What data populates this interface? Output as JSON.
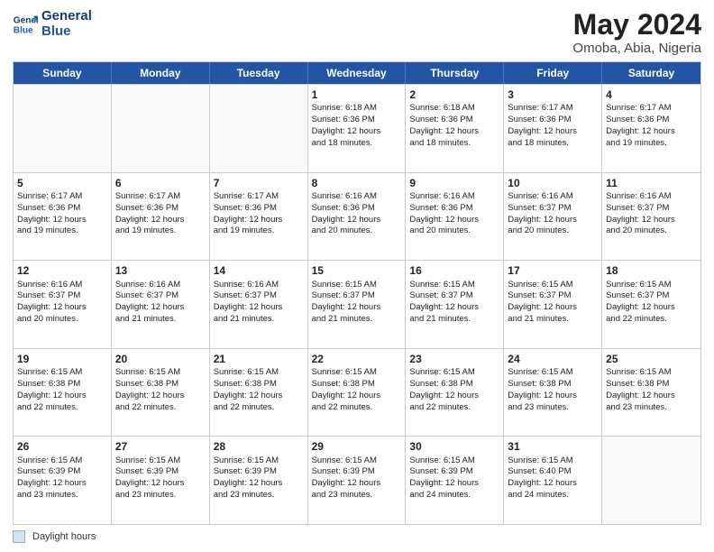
{
  "header": {
    "logo_line1": "General",
    "logo_line2": "Blue",
    "title": "May 2024",
    "subtitle": "Omoba, Abia, Nigeria"
  },
  "calendar": {
    "days_of_week": [
      "Sunday",
      "Monday",
      "Tuesday",
      "Wednesday",
      "Thursday",
      "Friday",
      "Saturday"
    ],
    "weeks": [
      [
        {
          "day": "",
          "info": "",
          "empty": true
        },
        {
          "day": "",
          "info": "",
          "empty": true
        },
        {
          "day": "",
          "info": "",
          "empty": true
        },
        {
          "day": "1",
          "info": "Sunrise: 6:18 AM\nSunset: 6:36 PM\nDaylight: 12 hours\nand 18 minutes.",
          "empty": false
        },
        {
          "day": "2",
          "info": "Sunrise: 6:18 AM\nSunset: 6:36 PM\nDaylight: 12 hours\nand 18 minutes.",
          "empty": false
        },
        {
          "day": "3",
          "info": "Sunrise: 6:17 AM\nSunset: 6:36 PM\nDaylight: 12 hours\nand 18 minutes.",
          "empty": false
        },
        {
          "day": "4",
          "info": "Sunrise: 6:17 AM\nSunset: 6:36 PM\nDaylight: 12 hours\nand 19 minutes.",
          "empty": false
        }
      ],
      [
        {
          "day": "5",
          "info": "Sunrise: 6:17 AM\nSunset: 6:36 PM\nDaylight: 12 hours\nand 19 minutes.",
          "empty": false
        },
        {
          "day": "6",
          "info": "Sunrise: 6:17 AM\nSunset: 6:36 PM\nDaylight: 12 hours\nand 19 minutes.",
          "empty": false
        },
        {
          "day": "7",
          "info": "Sunrise: 6:17 AM\nSunset: 6:36 PM\nDaylight: 12 hours\nand 19 minutes.",
          "empty": false
        },
        {
          "day": "8",
          "info": "Sunrise: 6:16 AM\nSunset: 6:36 PM\nDaylight: 12 hours\nand 20 minutes.",
          "empty": false
        },
        {
          "day": "9",
          "info": "Sunrise: 6:16 AM\nSunset: 6:36 PM\nDaylight: 12 hours\nand 20 minutes.",
          "empty": false
        },
        {
          "day": "10",
          "info": "Sunrise: 6:16 AM\nSunset: 6:37 PM\nDaylight: 12 hours\nand 20 minutes.",
          "empty": false
        },
        {
          "day": "11",
          "info": "Sunrise: 6:16 AM\nSunset: 6:37 PM\nDaylight: 12 hours\nand 20 minutes.",
          "empty": false
        }
      ],
      [
        {
          "day": "12",
          "info": "Sunrise: 6:16 AM\nSunset: 6:37 PM\nDaylight: 12 hours\nand 20 minutes.",
          "empty": false
        },
        {
          "day": "13",
          "info": "Sunrise: 6:16 AM\nSunset: 6:37 PM\nDaylight: 12 hours\nand 21 minutes.",
          "empty": false
        },
        {
          "day": "14",
          "info": "Sunrise: 6:16 AM\nSunset: 6:37 PM\nDaylight: 12 hours\nand 21 minutes.",
          "empty": false
        },
        {
          "day": "15",
          "info": "Sunrise: 6:15 AM\nSunset: 6:37 PM\nDaylight: 12 hours\nand 21 minutes.",
          "empty": false
        },
        {
          "day": "16",
          "info": "Sunrise: 6:15 AM\nSunset: 6:37 PM\nDaylight: 12 hours\nand 21 minutes.",
          "empty": false
        },
        {
          "day": "17",
          "info": "Sunrise: 6:15 AM\nSunset: 6:37 PM\nDaylight: 12 hours\nand 21 minutes.",
          "empty": false
        },
        {
          "day": "18",
          "info": "Sunrise: 6:15 AM\nSunset: 6:37 PM\nDaylight: 12 hours\nand 22 minutes.",
          "empty": false
        }
      ],
      [
        {
          "day": "19",
          "info": "Sunrise: 6:15 AM\nSunset: 6:38 PM\nDaylight: 12 hours\nand 22 minutes.",
          "empty": false
        },
        {
          "day": "20",
          "info": "Sunrise: 6:15 AM\nSunset: 6:38 PM\nDaylight: 12 hours\nand 22 minutes.",
          "empty": false
        },
        {
          "day": "21",
          "info": "Sunrise: 6:15 AM\nSunset: 6:38 PM\nDaylight: 12 hours\nand 22 minutes.",
          "empty": false
        },
        {
          "day": "22",
          "info": "Sunrise: 6:15 AM\nSunset: 6:38 PM\nDaylight: 12 hours\nand 22 minutes.",
          "empty": false
        },
        {
          "day": "23",
          "info": "Sunrise: 6:15 AM\nSunset: 6:38 PM\nDaylight: 12 hours\nand 22 minutes.",
          "empty": false
        },
        {
          "day": "24",
          "info": "Sunrise: 6:15 AM\nSunset: 6:38 PM\nDaylight: 12 hours\nand 23 minutes.",
          "empty": false
        },
        {
          "day": "25",
          "info": "Sunrise: 6:15 AM\nSunset: 6:38 PM\nDaylight: 12 hours\nand 23 minutes.",
          "empty": false
        }
      ],
      [
        {
          "day": "26",
          "info": "Sunrise: 6:15 AM\nSunset: 6:39 PM\nDaylight: 12 hours\nand 23 minutes.",
          "empty": false
        },
        {
          "day": "27",
          "info": "Sunrise: 6:15 AM\nSunset: 6:39 PM\nDaylight: 12 hours\nand 23 minutes.",
          "empty": false
        },
        {
          "day": "28",
          "info": "Sunrise: 6:15 AM\nSunset: 6:39 PM\nDaylight: 12 hours\nand 23 minutes.",
          "empty": false
        },
        {
          "day": "29",
          "info": "Sunrise: 6:15 AM\nSunset: 6:39 PM\nDaylight: 12 hours\nand 23 minutes.",
          "empty": false
        },
        {
          "day": "30",
          "info": "Sunrise: 6:15 AM\nSunset: 6:39 PM\nDaylight: 12 hours\nand 24 minutes.",
          "empty": false
        },
        {
          "day": "31",
          "info": "Sunrise: 6:15 AM\nSunset: 6:40 PM\nDaylight: 12 hours\nand 24 minutes.",
          "empty": false
        },
        {
          "day": "",
          "info": "",
          "empty": true
        }
      ]
    ]
  },
  "footer": {
    "legend_label": "Daylight hours"
  }
}
